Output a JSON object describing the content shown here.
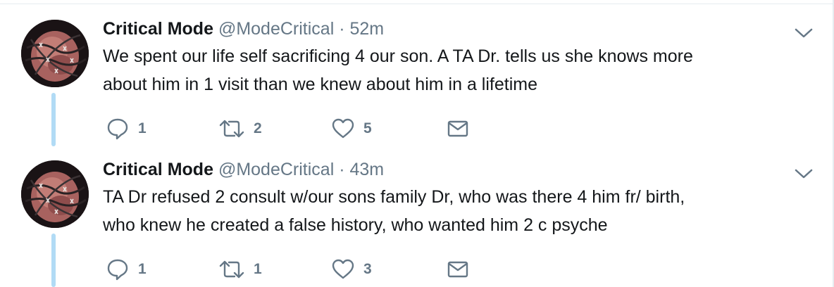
{
  "tweets": [
    {
      "author_name": "Critical Mode",
      "handle": "@ModeCritical",
      "separator": "·",
      "time": "52m",
      "text": "We spent our life self sacrificing 4 our son. A TA Dr. tells us she knows more\nabout him  in 1 visit than we knew about him in a lifetime",
      "reply_count": "1",
      "retweet_count": "2",
      "like_count": "5"
    },
    {
      "author_name": "Critical Mode",
      "handle": "@ModeCritical",
      "separator": "·",
      "time": "43m",
      "text": "TA Dr refused 2 consult w/our sons family Dr, who was there 4 him fr/ birth,\nwho knew he  created a false history, who wanted him 2 c psyche",
      "reply_count": "1",
      "retweet_count": "1",
      "like_count": "3"
    }
  ],
  "colors": {
    "text": "#14171a",
    "secondary": "#657786",
    "thread_line": "#b1dbf5",
    "border": "#e6ecf0"
  },
  "icons": [
    "reply-icon",
    "retweet-icon",
    "like-icon",
    "direct-message-icon",
    "chevron-down-icon"
  ]
}
